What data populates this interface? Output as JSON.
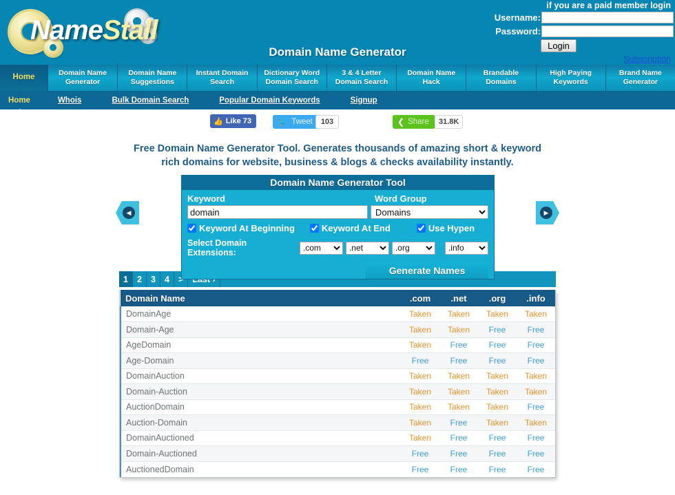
{
  "brand": {
    "name_white": "Name",
    "name_yellow": "Stall"
  },
  "login": {
    "note": "if you are a paid member login",
    "username_label": "Username:",
    "password_label": "Password:",
    "username_value": "",
    "password_value": "",
    "username_placeholder": "",
    "password_placeholder": "",
    "login_button": "Login",
    "subscription_link": "Subscription"
  },
  "page_title": "Domain Name Generator",
  "mainnav": [
    {
      "label": "Home",
      "active": true
    },
    {
      "label": "Domain Name Generator",
      "active": false
    },
    {
      "label": "Domain Name Suggestions",
      "active": false
    },
    {
      "label": "Instant Domain Search",
      "active": false
    },
    {
      "label": "Dictionary Word Domain Search",
      "active": false
    },
    {
      "label": "3 & 4 Letter Domain Search",
      "active": false
    },
    {
      "label": "Domain Name Hack",
      "active": false
    },
    {
      "label": "Brandable Domains",
      "active": false
    },
    {
      "label": "High Paying Keywords",
      "active": false
    },
    {
      "label": "Brand Name Generator",
      "active": false
    }
  ],
  "subnav": [
    {
      "label": "Home",
      "active": true
    },
    {
      "label": "Whois",
      "active": false
    },
    {
      "label": "Bulk Domain Search",
      "active": false
    },
    {
      "label": "Popular Domain Keywords",
      "active": false
    },
    {
      "label": "Signup",
      "active": false
    }
  ],
  "social": {
    "facebook_label": "Like",
    "facebook_count": "73",
    "twitter_label": "Tweet",
    "twitter_count": "103",
    "share_label": "Share",
    "share_count": "31.8K"
  },
  "headline": "Free Domain Name Generator Tool. Generates thousands of amazing short & keyword rich domains for website, business & blogs & checks availability instantly.",
  "tool": {
    "title": "Domain Name Generator Tool",
    "keyword_label": "Keyword",
    "keyword_value": "domain",
    "keyword_placeholder": "",
    "word_group_label": "Word Group",
    "word_group_value": "Domains",
    "word_group_options": [
      "Domains"
    ],
    "checkboxes": [
      {
        "label": "Keyword At Beginning",
        "checked": true
      },
      {
        "label": "Keyword At End",
        "checked": true
      },
      {
        "label": "Use Hypen",
        "checked": true
      }
    ],
    "extensions_label": "Select Domain Extensions:",
    "extension_selects": [
      ".com",
      ".net",
      ".org",
      ".info"
    ],
    "generate_button": "Generate Names",
    "prev_arrow": "◀",
    "next_arrow": "▶"
  },
  "pager": [
    {
      "label": "1",
      "active": true
    },
    {
      "label": "2",
      "active": false
    },
    {
      "label": "3",
      "active": false
    },
    {
      "label": "4",
      "active": false
    },
    {
      "label": ">",
      "active": false
    },
    {
      "label": "Last ›",
      "active": false
    }
  ],
  "table": {
    "columns": [
      "Domain Name",
      ".com",
      ".net",
      ".org",
      ".info"
    ],
    "rows": [
      {
        "name": "DomainAge",
        "com": "Taken",
        "net": "Taken",
        "org": "Taken",
        "info": "Taken"
      },
      {
        "name": "Domain-Age",
        "com": "Taken",
        "net": "Taken",
        "org": "Free",
        "info": "Free"
      },
      {
        "name": "AgeDomain",
        "com": "Taken",
        "net": "Free",
        "org": "Free",
        "info": "Free"
      },
      {
        "name": "Age-Domain",
        "com": "Free",
        "net": "Free",
        "org": "Free",
        "info": "Free"
      },
      {
        "name": "DomainAuction",
        "com": "Taken",
        "net": "Taken",
        "org": "Taken",
        "info": "Taken"
      },
      {
        "name": "Domain-Auction",
        "com": "Taken",
        "net": "Taken",
        "org": "Taken",
        "info": "Taken"
      },
      {
        "name": "AuctionDomain",
        "com": "Taken",
        "net": "Taken",
        "org": "Taken",
        "info": "Free"
      },
      {
        "name": "Auction-Domain",
        "com": "Taken",
        "net": "Free",
        "org": "Taken",
        "info": "Taken"
      },
      {
        "name": "DomainAuctioned",
        "com": "Taken",
        "net": "Free",
        "org": "Free",
        "info": "Free"
      },
      {
        "name": "Domain-Auctioned",
        "com": "Free",
        "net": "Free",
        "org": "Free",
        "info": "Free"
      },
      {
        "name": "AuctionedDomain",
        "com": "Free",
        "net": "Free",
        "org": "Free",
        "info": "Free"
      }
    ]
  },
  "colors": {
    "header_bg": "#0586b3",
    "nav_active": "#0a5c85",
    "accent_yellow": "#f0e26a",
    "panel_bg": "#16aed2",
    "panel_head": "#0c6d99",
    "table_head": "#175a87",
    "taken": "#e8922a",
    "free": "#3d9fd4",
    "headline_text": "#1f5d86"
  }
}
